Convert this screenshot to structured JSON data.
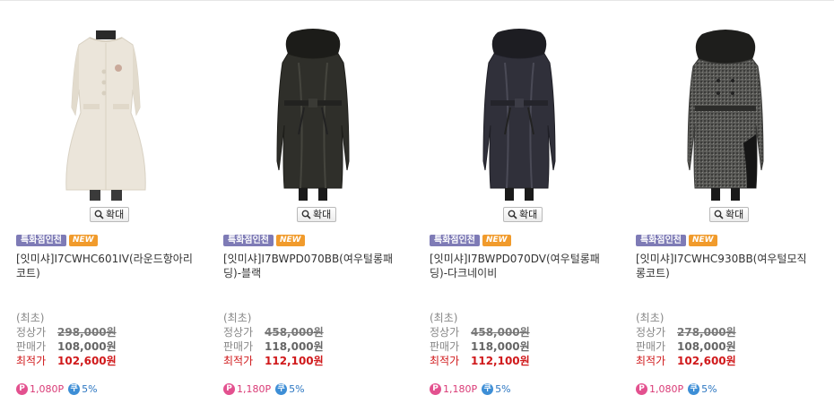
{
  "labels": {
    "zoom": "확대",
    "badge_recommend": "특화점인천",
    "badge_new": "NEW",
    "lowest_note": "(최초)",
    "regular_price_label": "정상가",
    "sale_price_label": "판매가",
    "best_price_label": "최적가",
    "point_icon": "P",
    "coupon_icon": "쿠"
  },
  "products": [
    {
      "name": "[잇미샤]I7CWHC601IV(라운드항아리코트)",
      "regular_price": "298,000원",
      "sale_price": "108,000원",
      "best_price": "102,600원",
      "points": "1,080P",
      "coupon": "5%",
      "coat_color": "#e9e3d8",
      "coat_style": "cream-round"
    },
    {
      "name": "[잇미샤]I7BWPD070BB(여우털롱패딩)-블랙",
      "regular_price": "458,000원",
      "sale_price": "118,000원",
      "best_price": "112,100원",
      "points": "1,180P",
      "coupon": "5%",
      "coat_color": "#2b2b26",
      "coat_style": "black-padding"
    },
    {
      "name": "[잇미샤]I7BWPD070DV(여우털롱패딩)-다크네이비",
      "regular_price": "458,000원",
      "sale_price": "118,000원",
      "best_price": "112,100원",
      "points": "1,180P",
      "coupon": "5%",
      "coat_color": "#2a2a33",
      "coat_style": "navy-padding"
    },
    {
      "name": "[잇미샤]I7CWHC930BB(여우털모직롱코트)",
      "regular_price": "278,000원",
      "sale_price": "108,000원",
      "best_price": "102,600원",
      "points": "1,080P",
      "coupon": "5%",
      "coat_color": "#4a4a48",
      "coat_style": "tweed-fur"
    }
  ]
}
